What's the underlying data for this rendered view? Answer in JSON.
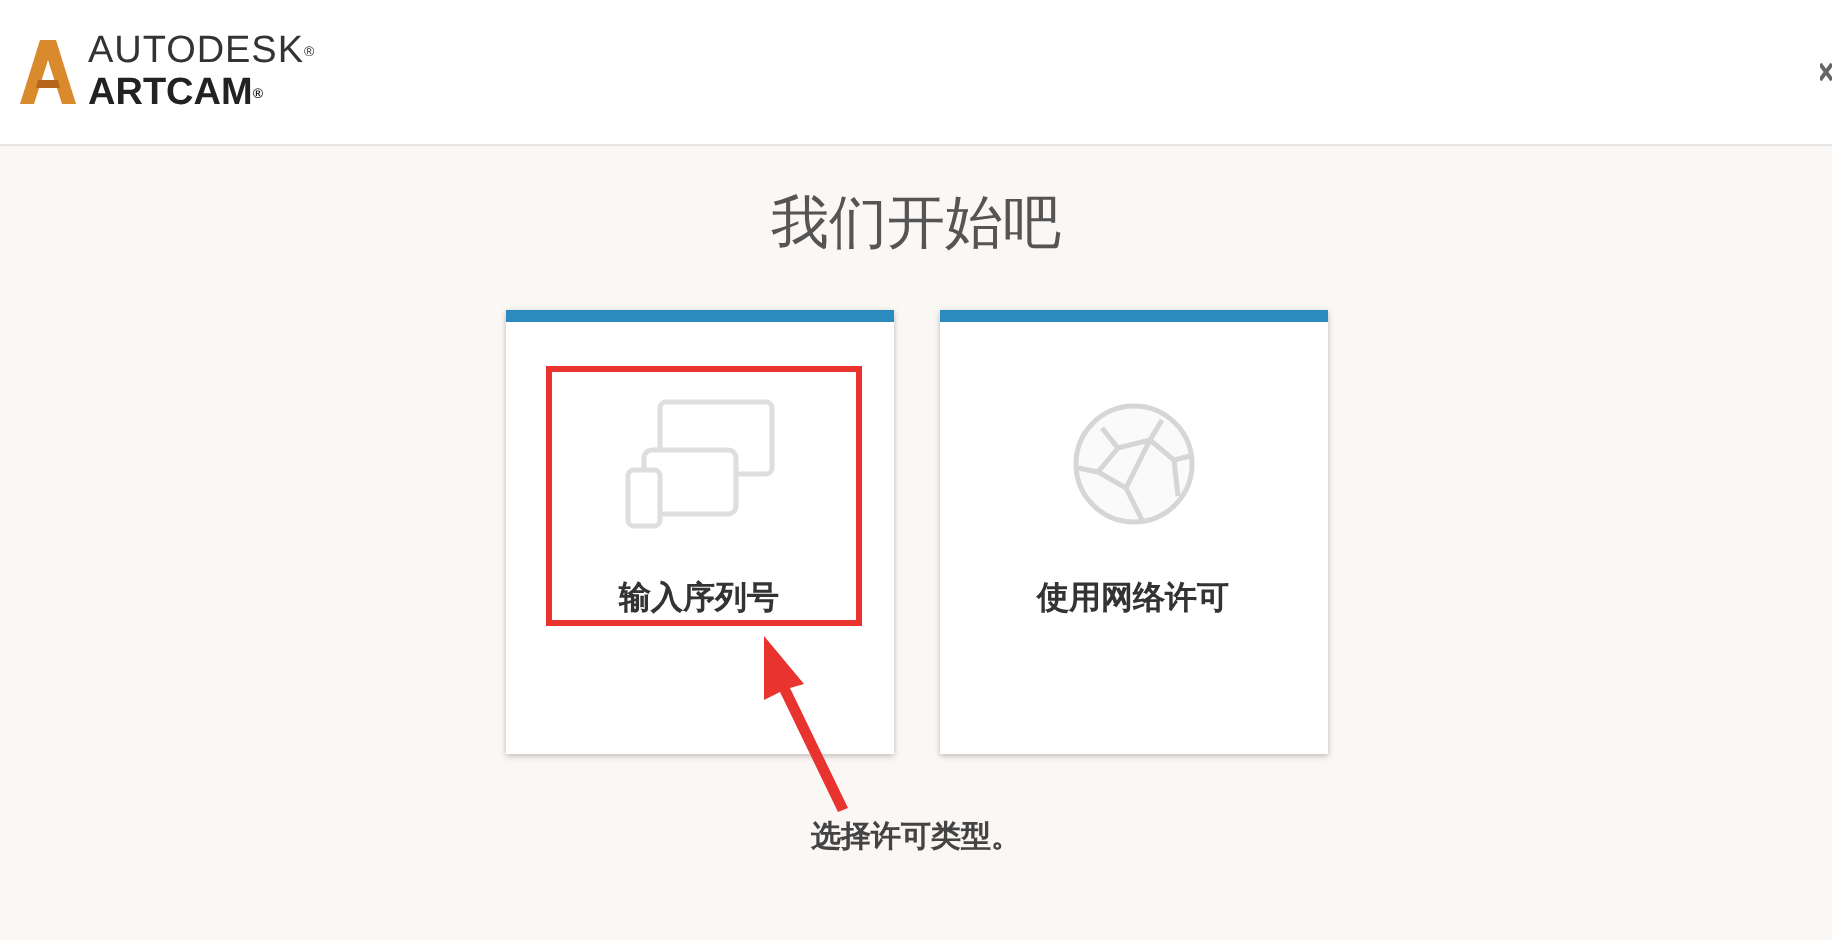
{
  "header": {
    "brand_top": "AUTODESK",
    "brand_bottom": "ARTCAM",
    "mark": "®"
  },
  "title": "我们开始吧",
  "options": [
    {
      "kind": "serial",
      "label": "输入序列号",
      "highlighted": true
    },
    {
      "kind": "network",
      "label": "使用网络许可",
      "highlighted": false
    }
  ],
  "footer": "选择许可类型。"
}
